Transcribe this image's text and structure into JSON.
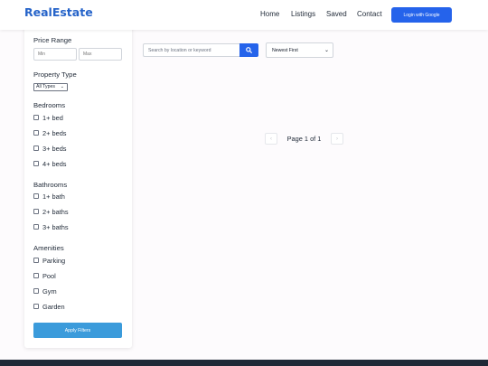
{
  "brand": {
    "name": "RealEstate"
  },
  "nav": {
    "links": [
      "Home",
      "Listings",
      "Saved",
      "Contact"
    ],
    "login_label": "Login with Google"
  },
  "filters": {
    "price": {
      "heading": "Price Range",
      "min_placeholder": "Min",
      "max_placeholder": "Max"
    },
    "property_type": {
      "heading": "Property Type",
      "selected": "All Types"
    },
    "bedrooms": {
      "heading": "Bedrooms",
      "options": [
        "1+ bed",
        "2+ beds",
        "3+ beds",
        "4+ beds"
      ]
    },
    "bathrooms": {
      "heading": "Bathrooms",
      "options": [
        "1+ bath",
        "2+ baths",
        "3+ baths"
      ]
    },
    "amenities": {
      "heading": "Amenities",
      "options": [
        "Parking",
        "Pool",
        "Gym",
        "Garden"
      ]
    },
    "apply_label": "Apply Filters"
  },
  "search": {
    "placeholder": "Search by location or keyword",
    "icon": "search-icon",
    "sort_selected": "Newest First"
  },
  "pagination": {
    "text": "Page 1 of 1",
    "prev_icon": "chevron-left-icon",
    "next_icon": "chevron-right-icon"
  },
  "colors": {
    "brand": "#2563c9",
    "primary_button": "#2563eb",
    "apply_button": "#3b9bdb",
    "footer": "#1f2937"
  }
}
